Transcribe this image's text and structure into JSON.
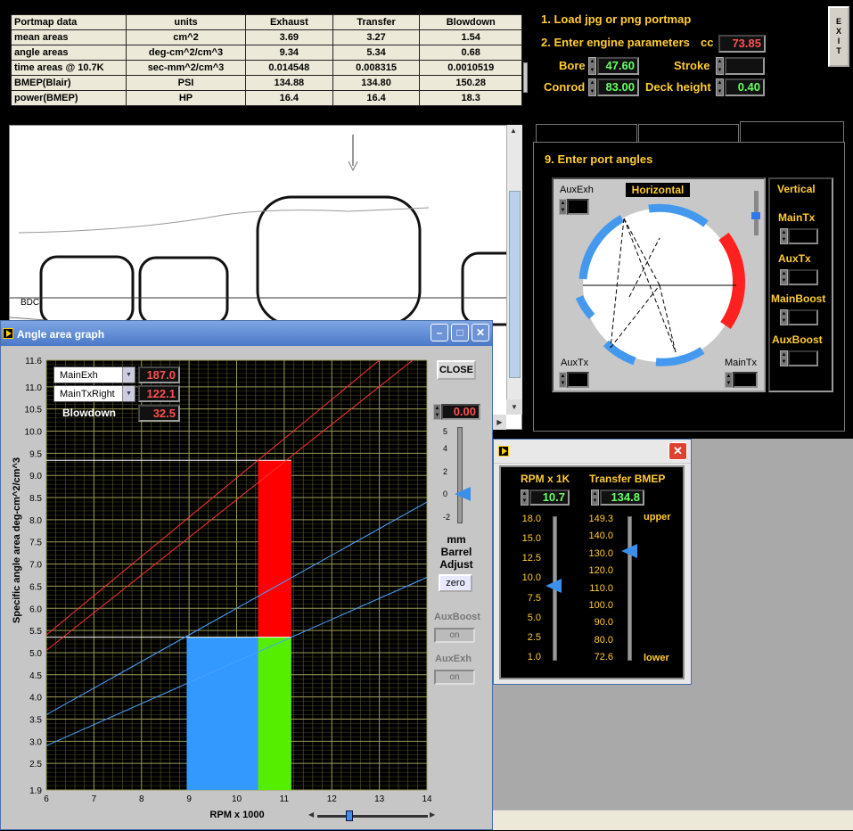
{
  "table": {
    "headers": [
      "Portmap data",
      "units",
      "Exhaust",
      "Transfer",
      "Blowdown"
    ],
    "rows": [
      [
        "mean areas",
        "cm^2",
        "3.69",
        "3.27",
        "1.54"
      ],
      [
        "angle areas",
        "deg-cm^2/cm^3",
        "9.34",
        "5.34",
        "0.68"
      ],
      [
        "time areas @ 10.7K",
        "sec-mm^2/cm^3",
        "0.014548",
        "0.008315",
        "0.0010519"
      ],
      [
        "BMEP(Blair)",
        "PSI",
        "134.88",
        "134.80",
        "150.28"
      ],
      [
        "power(BMEP)",
        "HP",
        "16.4",
        "16.4",
        "18.3"
      ]
    ]
  },
  "exit_label": "EXIT",
  "steps": {
    "step1": "1. Load jpg or png portmap",
    "step2": "2. Enter engine parameters",
    "step9": "9. Enter port angles"
  },
  "engine": {
    "cc_label": "cc",
    "cc": "73.85",
    "bore_label": "Bore",
    "bore": "47.60",
    "stroke_label": "Stroke",
    "stroke": "",
    "conrod_label": "Conrod",
    "conrod": "83.00",
    "deck_label": "Deck height",
    "deck": "0.40"
  },
  "ports": {
    "horizontal_label": "Horizontal",
    "vertical_label": "Vertical",
    "auxexh": "AuxExh",
    "auxtx": "AuxTx",
    "maintx": "MainTx",
    "v_maintx": "MainTx",
    "v_auxtx": "AuxTx",
    "v_mainboost": "MainBoost",
    "v_auxboost": "AuxBoost"
  },
  "sketch": {
    "bdc_label": "BDC"
  },
  "angle_graph": {
    "title": "Angle area graph",
    "close_label": "CLOSE",
    "sel1": "MainExh",
    "val1": "187.0",
    "sel2": "MainTxRight",
    "val2": "122.1",
    "blowdown_label": "Blowdown",
    "blowdown": "32.5",
    "barrel_value": "0.00",
    "barrel_ticks": [
      "5",
      "4",
      "2",
      "0",
      "-2"
    ],
    "barrel_label1": "mm",
    "barrel_label2": "Barrel",
    "barrel_label3": "Adjust",
    "zero_label": "zero",
    "auxboost_label": "AuxBoost",
    "auxboost_btn": "on",
    "auxexh_label": "AuxExh",
    "auxexh_btn": "on",
    "slider_value": 0.09
  },
  "chart_data": {
    "type": "line",
    "xlabel": "RPM x 1000",
    "ylabel": "Specific angle area  deg-cm^2/cm^3",
    "xlim": [
      6,
      14
    ],
    "ylim": [
      1.9,
      11.6
    ],
    "xticks": [
      6,
      7,
      8,
      9,
      10,
      11,
      12,
      13,
      14
    ],
    "yticks": [
      1.9,
      2.5,
      3.0,
      3.5,
      4.0,
      4.5,
      5.0,
      5.5,
      6.0,
      6.5,
      7.0,
      7.5,
      8.0,
      8.5,
      9.0,
      9.5,
      10.0,
      10.5,
      11.0,
      11.6
    ],
    "ytick_labels": [
      "1.9",
      "2.5",
      "3.0",
      "3.5",
      "4.0",
      "4.5",
      "5.0",
      "5.5",
      "6.0",
      "6.5",
      "7.0",
      "7.5",
      "8.0",
      "8.5",
      "9.0",
      "9.5",
      "10.0",
      "10.5",
      "11.0",
      "11.6"
    ],
    "grid": true,
    "lines": [
      {
        "color": "#ff3030",
        "x": [
          6,
          13.0
        ],
        "y": [
          5.4,
          11.6
        ]
      },
      {
        "color": "#ff3030",
        "x": [
          6,
          13.7
        ],
        "y": [
          5.05,
          11.6
        ]
      },
      {
        "color": "#4aa0ff",
        "x": [
          6,
          14
        ],
        "y": [
          3.6,
          8.4
        ]
      },
      {
        "color": "#4aa0ff",
        "x": [
          6,
          14
        ],
        "y": [
          2.9,
          6.7
        ]
      }
    ],
    "bars": [
      {
        "color": "#3399ff",
        "x0": 8.95,
        "x1": 10.45,
        "y0": 1.9,
        "y1": 5.35
      },
      {
        "color": "#55ee00",
        "x0": 10.45,
        "x1": 11.15,
        "y0": 1.9,
        "y1": 5.35
      },
      {
        "color": "#ff0000",
        "x0": 10.45,
        "x1": 11.15,
        "y0": 5.35,
        "y1": 9.34
      }
    ],
    "hlines": [
      5.35,
      9.34
    ]
  },
  "rpm_window": {
    "rpm_label": "RPM x 1K",
    "rpm_value": "10.7",
    "rpm_ticks": [
      "18.0",
      "15.0",
      "12.5",
      "10.0",
      "7.5",
      "5.0",
      "2.5",
      "1.0"
    ],
    "bmep_label": "Transfer BMEP",
    "bmep_value": "134.8",
    "bmep_ticks": [
      "149.3",
      "140.0",
      "130.0",
      "120.0",
      "110.0",
      "100.0",
      "90.0",
      "80.0",
      "72.6"
    ],
    "upper_label": "upper",
    "lower_label": "lower",
    "rpm_level": 0.55,
    "bmep_level": 0.8
  },
  "colors": {
    "accent_yellow": "#ffcc33",
    "value_red": "#ff5050",
    "value_green": "#66ff66"
  }
}
